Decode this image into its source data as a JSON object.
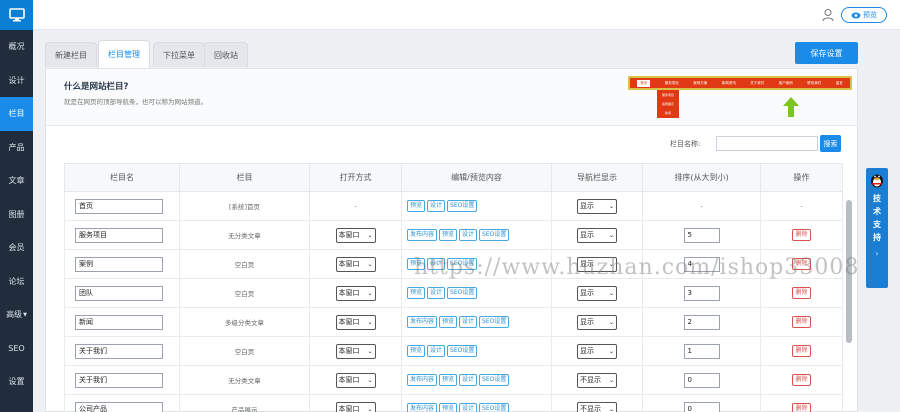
{
  "sidebar": {
    "items": [
      {
        "label": "概况"
      },
      {
        "label": "设计"
      },
      {
        "label": "栏目"
      },
      {
        "label": "产品"
      },
      {
        "label": "文章"
      },
      {
        "label": "图册"
      },
      {
        "label": "会员"
      },
      {
        "label": "论坛"
      },
      {
        "label": "高级"
      },
      {
        "label": "SEO"
      },
      {
        "label": "设置"
      }
    ],
    "active_index": 2
  },
  "topbar": {
    "preview_label": "预览"
  },
  "tabs": [
    {
      "label": "新建栏目"
    },
    {
      "label": "栏目管理"
    },
    {
      "label": "下拉菜单"
    },
    {
      "label": "回收站"
    }
  ],
  "save_label": "保存设置",
  "info": {
    "title": "什么是网站栏目?",
    "desc": "就是在网页的顶部导航条，也可以称为网站频道。"
  },
  "mini_nav": {
    "items": [
      "首页",
      "服务项目",
      "案例方案",
      "新闻资讯",
      "关于我们",
      "客户案例",
      "联系我们",
      "留言"
    ],
    "dropdown": [
      "服务项目",
      "案例展示",
      "新闻"
    ]
  },
  "search": {
    "label": "栏目名称:",
    "button": "搜索"
  },
  "table": {
    "headers": [
      "栏目名",
      "栏目",
      "打开方式",
      "编辑/预览内容",
      "导航栏显示",
      "排序(从大到小)",
      "操作"
    ],
    "rows": [
      {
        "name": "首页",
        "type": "[系统]首页",
        "open": "-",
        "actions": [
          "预览",
          "设计",
          "SEO设置"
        ],
        "display": "显示",
        "order": "-",
        "op": "-"
      },
      {
        "name": "服务项目",
        "type": "无分类文章",
        "open": "本窗口",
        "actions": [
          "发布内容",
          "预览",
          "设计",
          "SEO设置"
        ],
        "display": "显示",
        "order": "5",
        "op": "删除"
      },
      {
        "name": "案例",
        "type": "空白页",
        "open": "本窗口",
        "actions": [
          "预览",
          "设计",
          "SEO设置"
        ],
        "display": "显示",
        "order": "4",
        "op": "删除"
      },
      {
        "name": "团队",
        "type": "空白页",
        "open": "本窗口",
        "actions": [
          "预览",
          "设计",
          "SEO设置"
        ],
        "display": "显示",
        "order": "3",
        "op": "删除"
      },
      {
        "name": "新闻",
        "type": "多级分类文章",
        "open": "本窗口",
        "actions": [
          "发布内容",
          "预览",
          "设计",
          "SEO设置"
        ],
        "display": "显示",
        "order": "2",
        "op": "删除"
      },
      {
        "name": "关于我们",
        "type": "空白页",
        "open": "本窗口",
        "actions": [
          "预览",
          "设计",
          "SEO设置"
        ],
        "display": "显示",
        "order": "1",
        "op": "删除"
      },
      {
        "name": "关于我们",
        "type": "无分类文章",
        "open": "本窗口",
        "actions": [
          "发布内容",
          "预览",
          "设计",
          "SEO设置"
        ],
        "display": "不显示",
        "order": "0",
        "op": "删除"
      },
      {
        "name": "公司产品",
        "type": "产品展示",
        "open": "本窗口",
        "actions": [
          "发布内容",
          "预览",
          "设计",
          "SEO设置"
        ],
        "display": "不显示",
        "order": "0",
        "op": "删除"
      }
    ]
  },
  "support_label": "技术支持",
  "watermark": "https://www.huzhan.com/ishop33008",
  "colors": {
    "accent": "#1a8be8",
    "sidebar_bg": "#1f2d3d",
    "danger": "#d9534f",
    "banner_red": "#e03a14"
  }
}
